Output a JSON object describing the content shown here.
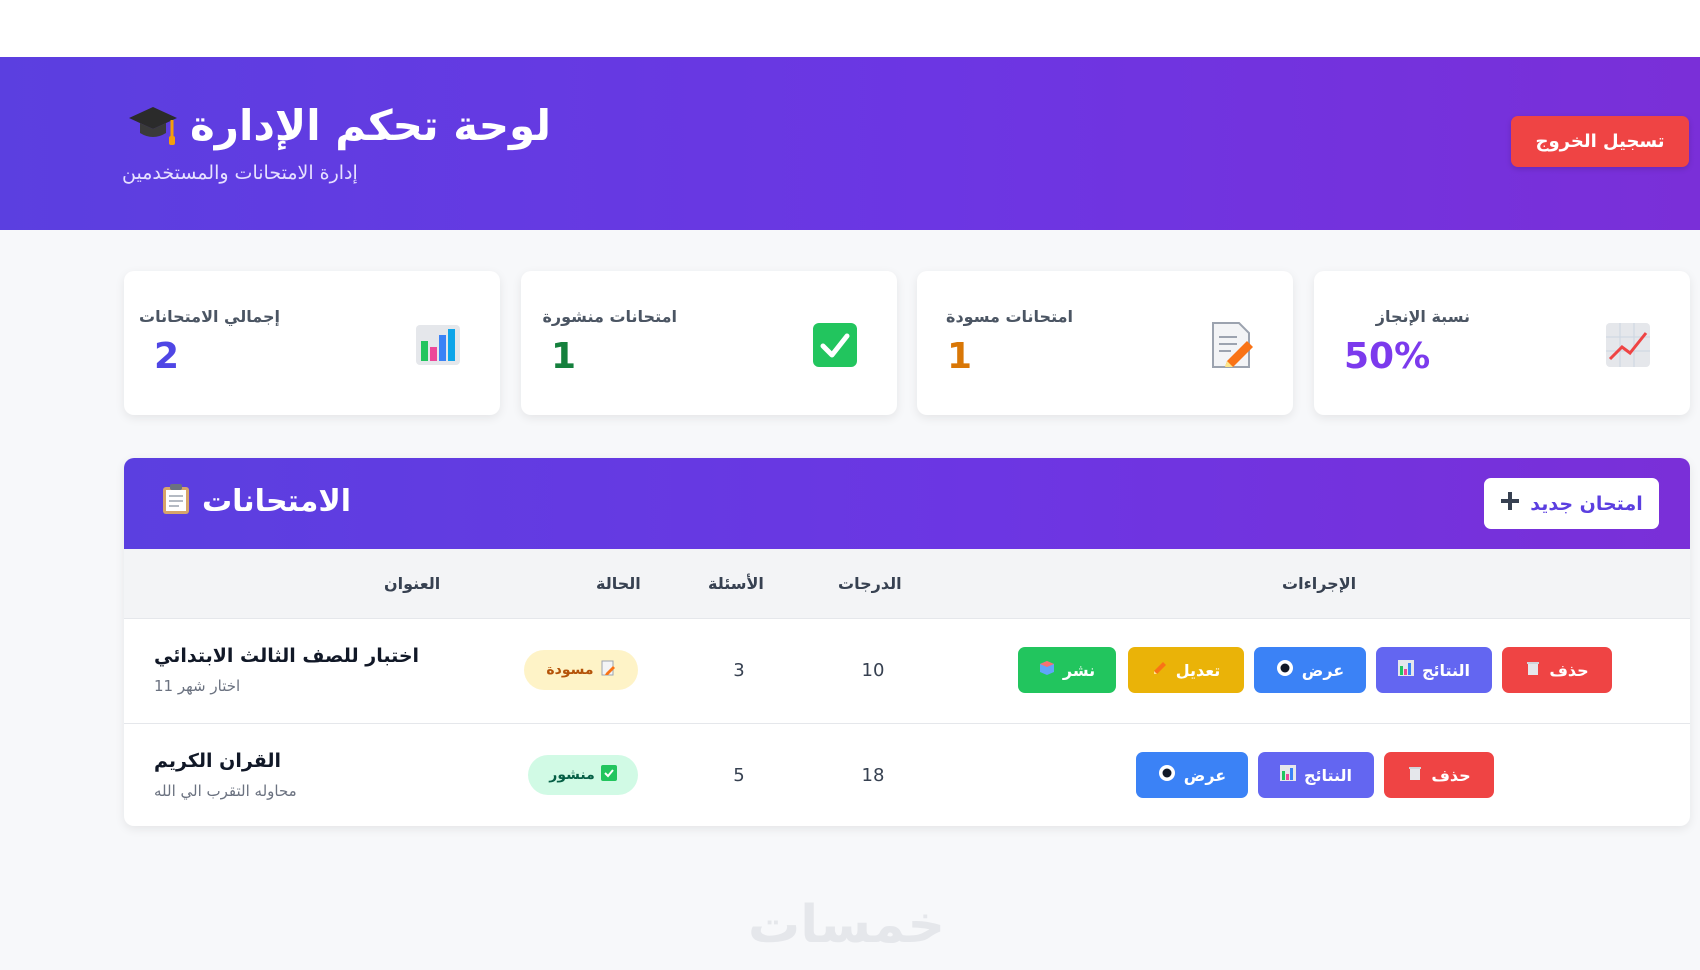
{
  "header": {
    "title": "لوحة تحكم الإدارة",
    "subtitle": "إدارة الامتحانات والمستخدمين",
    "logout_label": "تسجيل الخروج"
  },
  "stats": [
    {
      "label": "إجمالي الامتحانات",
      "value": "2",
      "color": "#4f46e5",
      "icon": "bar-chart-icon"
    },
    {
      "label": "امتحانات منشورة",
      "value": "1",
      "color": "#15803d",
      "icon": "check-box-icon"
    },
    {
      "label": "امتحانات مسودة",
      "value": "1",
      "color": "#d97706",
      "icon": "memo-icon"
    },
    {
      "label": "نسبة الإنجاز",
      "value": "50%",
      "color": "#7c3aed",
      "icon": "trend-chart-icon"
    }
  ],
  "panel": {
    "title": "الامتحانات",
    "new_exam_label": "امتحان جديد"
  },
  "table": {
    "headers": {
      "title": "العنوان",
      "status": "الحالة",
      "questions": "الأسئلة",
      "points": "الدرجات",
      "actions": "الإجراءات"
    },
    "rows": [
      {
        "title": "اختبار للصف الثالث الابتدائي",
        "desc": "اختار شهر 11",
        "status": "مسودة",
        "questions": "3",
        "points": "10",
        "actions": {
          "delete": "حذف",
          "results": "النتائج",
          "view": "عرض",
          "edit": "تعديل",
          "publish": "نشر"
        }
      },
      {
        "title": "القران الكريم",
        "desc": "محاوله التقرب الي الله",
        "status": "منشور",
        "questions": "5",
        "points": "18",
        "actions": {
          "delete": "حذف",
          "results": "النتائج",
          "view": "عرض"
        }
      }
    ]
  },
  "watermark": "خمسات",
  "colors": {
    "header_gradient_start": "#5b3fe0",
    "header_gradient_end": "#7a2fd8",
    "danger": "#ef4444",
    "primary": "#6366f1",
    "info": "#3b82f6",
    "warning": "#eab308",
    "success": "#22c55e"
  }
}
